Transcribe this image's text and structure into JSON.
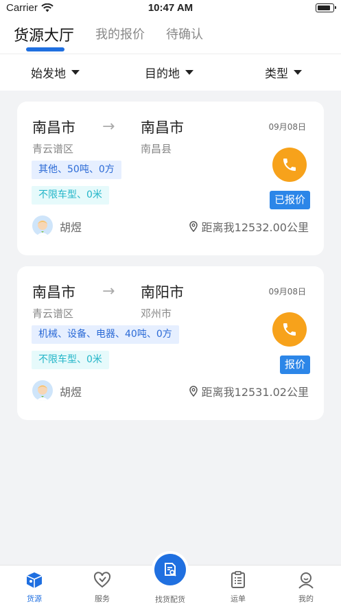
{
  "status_bar": {
    "carrier": "Carrier",
    "time": "10:47 AM"
  },
  "tabs": [
    {
      "label": "货源大厅",
      "active": true
    },
    {
      "label": "我的报价",
      "active": false
    },
    {
      "label": "待确认",
      "active": false
    }
  ],
  "filters": [
    {
      "label": "始发地"
    },
    {
      "label": "目的地"
    },
    {
      "label": "类型"
    }
  ],
  "cards": [
    {
      "from_city": "南昌市",
      "from_district": "青云谱区",
      "to_city": "南昌市",
      "to_district": "南昌县",
      "date": "09月08日",
      "cargo": "其他、50吨、0方",
      "vehicle": "不限车型、0米",
      "quote_label": "已报价",
      "user": "胡煜",
      "distance": "距离我12532.00公里"
    },
    {
      "from_city": "南昌市",
      "from_district": "青云谱区",
      "to_city": "南阳市",
      "to_district": "邓州市",
      "date": "09月08日",
      "cargo": "机械、设备、电器、40吨、0方",
      "vehicle": "不限车型、0米",
      "quote_label": "报价",
      "user": "胡煜",
      "distance": "距离我12531.02公里"
    }
  ],
  "tabbar": {
    "items": [
      {
        "label": "货源",
        "icon": "cube-icon",
        "active": true
      },
      {
        "label": "服务",
        "icon": "heart-icon",
        "active": false
      },
      {
        "label": "找货配货",
        "icon": "document-search-icon",
        "active": false
      },
      {
        "label": "运单",
        "icon": "clipboard-icon",
        "active": false
      },
      {
        "label": "我的",
        "icon": "user-icon",
        "active": false
      }
    ]
  },
  "colors": {
    "accent": "#1f6fe0",
    "phone": "#f7a21b",
    "cargo_tag_bg": "#e6efff",
    "vehicle_tag_text": "#23b5c8"
  }
}
